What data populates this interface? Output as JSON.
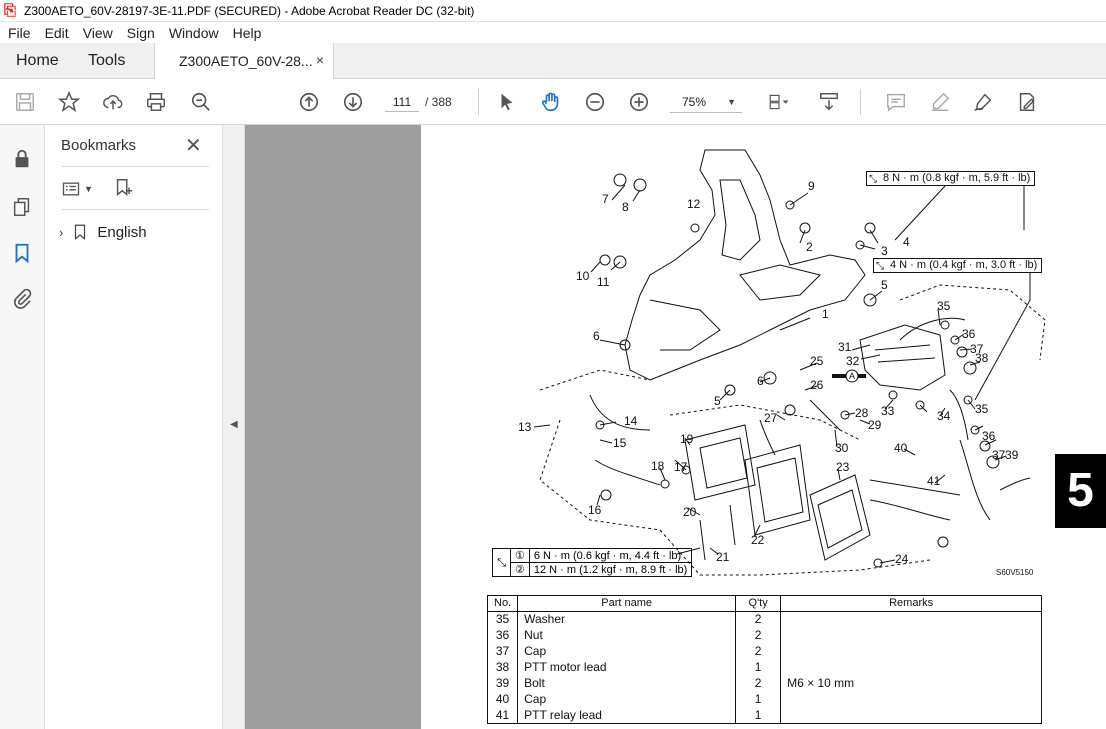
{
  "window": {
    "title": "Z300AETO_60V-28197-3E-11.PDF (SECURED) - Adobe Acrobat Reader DC (32-bit)"
  },
  "menu": [
    "File",
    "Edit",
    "View",
    "Sign",
    "Window",
    "Help"
  ],
  "tabs": {
    "home": "Home",
    "tools": "Tools",
    "document": "Z300AETO_60V-28...",
    "close": "×"
  },
  "toolbar": {
    "page_current": "111",
    "page_total": "/ 388",
    "zoom": "75%"
  },
  "bookmarks": {
    "title": "Bookmarks",
    "close": "✕",
    "items": [
      {
        "label": "English"
      }
    ]
  },
  "document": {
    "torque_notes": {
      "t1": "8 N · m (0.8 kgf · m, 5.9 ft · lb)",
      "t2": "4 N · m (0.4 kgf · m, 3.0 ft · lb)"
    },
    "torque_table": [
      {
        "mark": "①",
        "value": "6 N · m (0.6 kgf · m, 4.4 ft · lb)"
      },
      {
        "mark": "②",
        "value": "12 N · m (1.2 kgf · m, 8.9 ft · lb)"
      }
    ],
    "figure_code": "S60V5150",
    "section_number": "5",
    "callouts": [
      "1",
      "2",
      "3",
      "4",
      "5",
      "5",
      "6",
      "6",
      "7",
      "8",
      "9",
      "10",
      "11",
      "12",
      "13",
      "14",
      "15",
      "16",
      "17",
      "18",
      "19",
      "20",
      "21",
      "22",
      "23",
      "24",
      "25",
      "26",
      "27",
      "28",
      "29",
      "30",
      "31",
      "32",
      "33",
      "34",
      "35",
      "35",
      "36",
      "36",
      "37",
      "37",
      "38",
      "39",
      "40",
      "41",
      "A"
    ],
    "parts_table": {
      "headers": {
        "no": "No.",
        "name": "Part name",
        "qty": "Q'ty",
        "remarks": "Remarks"
      },
      "rows": [
        {
          "no": "35",
          "name": "Washer",
          "qty": "2",
          "remarks": ""
        },
        {
          "no": "36",
          "name": "Nut",
          "qty": "2",
          "remarks": ""
        },
        {
          "no": "37",
          "name": "Cap",
          "qty": "2",
          "remarks": ""
        },
        {
          "no": "38",
          "name": "PTT motor lead",
          "qty": "1",
          "remarks": ""
        },
        {
          "no": "39",
          "name": "Bolt",
          "qty": "2",
          "remarks": "M6 × 10 mm"
        },
        {
          "no": "40",
          "name": "Cap",
          "qty": "1",
          "remarks": ""
        },
        {
          "no": "41",
          "name": "PTT relay lead",
          "qty": "1",
          "remarks": ""
        }
      ]
    }
  }
}
